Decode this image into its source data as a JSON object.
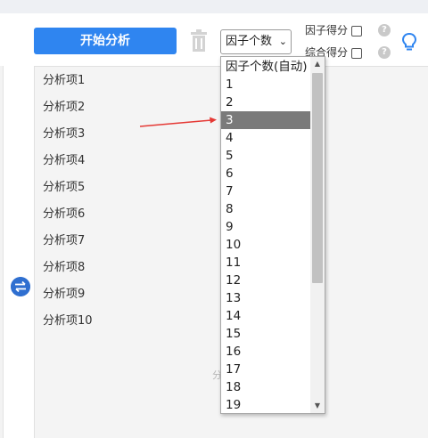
{
  "toolbar": {
    "start_label": "开始分析",
    "factor_select_value": "因子个数",
    "factor_score_label": "因子得分",
    "composite_score_label": "综合得分",
    "help_glyph": "?"
  },
  "analysis_items": [
    "分析项1",
    "分析项2",
    "分析项3",
    "分析项4",
    "分析项5",
    "分析项6",
    "分析项7",
    "分析项8",
    "分析项9",
    "分析项10"
  ],
  "faint_text": "分",
  "dropdown": {
    "options": [
      "因子个数(自动)",
      "1",
      "2",
      "3",
      "4",
      "5",
      "6",
      "7",
      "8",
      "9",
      "10",
      "11",
      "12",
      "13",
      "14",
      "15",
      "16",
      "17",
      "18",
      "19"
    ],
    "selected_index": 3
  },
  "colors": {
    "primary": "#2f85f0",
    "selected_option": "#7a7a7a",
    "arrow": "#e53935"
  },
  "icons": [
    "trash-icon",
    "chevron-down-icon",
    "help-icon",
    "lightbulb-icon",
    "swap-icon",
    "scroll-up-icon",
    "scroll-down-icon",
    "arrow-pointer-icon"
  ]
}
